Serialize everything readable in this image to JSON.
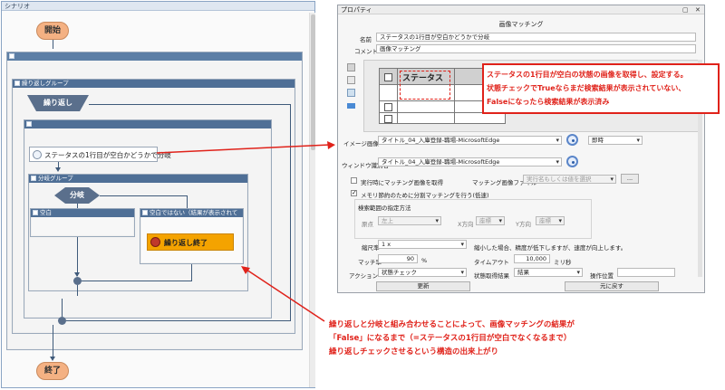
{
  "scenario": {
    "title": "シナリオ",
    "start": "開始",
    "end": "終了",
    "loop_group": "繰り返しグループ",
    "loop": "繰り返し",
    "image_match_step": "ステータスの1行目が空白かどうかで分岐",
    "branch_group": "分岐グループ",
    "branch": "分岐",
    "branch_left": "空白",
    "branch_right": "空白ではない（結果が表示されている）",
    "loop_end": "繰り返し終了"
  },
  "props": {
    "title": "プロパティ",
    "heading": "画像マッチング",
    "name_label": "名前",
    "name_value": "ステータスの1行目が空白かどうかで分岐",
    "comment_label": "コメント",
    "comment_value": "画像マッチング",
    "preview_cell": "ステータス",
    "image_label": "イメージ画像",
    "image_value": "タイトル_04_入庫登録-職場-MicrosoftEdge",
    "timing_value": "即時",
    "window_label": "ウィンドウ識別名",
    "window_value": "タイトル_04_入庫登録-職場-MicrosoftEdge",
    "exec_match_label": "実行時にマッチング画像を取得",
    "match_file_label": "マッチング画像ファイル",
    "match_file_value": "実行名もしくは値を選択",
    "browse_label": "...",
    "memory_label": "メモリ節約のために分割マッチングを行う(低速)",
    "search_range_label": "検索範囲の指定方法",
    "origin_label": "原点",
    "origin_value": "左上",
    "xdir_label": "X方向",
    "xdir_value": "座標",
    "ydir_label": "Y方向",
    "ydir_value": "座標",
    "scale_label": "縮尺率",
    "scale_value": "1 x",
    "scale_note": "縮小した場合、精度が低下しますが、速度が向上します。",
    "match_rate_label": "マッチ率",
    "match_rate_value": "90",
    "percent": "%",
    "timeout_label": "タイムアウト",
    "timeout_value": "10,000",
    "ms": "ミリ秒",
    "action_label": "アクション",
    "action_value": "状態チェック",
    "state_result_label": "状態取得結果",
    "state_result_value": "結果",
    "op_pos_label": "操作位置",
    "update_button": "更新",
    "restore_button": "元に戻す"
  },
  "annotations": {
    "top": [
      "ステータスの1行目が空白の状態の画像を取得し、設定する。",
      "状態チェックでTrueならまだ検索結果が表示されていない、",
      "Falseになったら検索結果が表示済み"
    ],
    "bottom": [
      "繰り返しと分岐と組み合わせることによって、画像マッチングの結果が",
      "「False」になるまで（=ステータスの1行目が空白でなくなるまで）",
      "繰り返しチェックさせるという構造の出来上がり"
    ]
  },
  "colors": {
    "accent_red": "#e0221a",
    "group_header": "#4f6f96",
    "start_end": "#f4b183",
    "loop_end_fill": "#f4a300"
  }
}
